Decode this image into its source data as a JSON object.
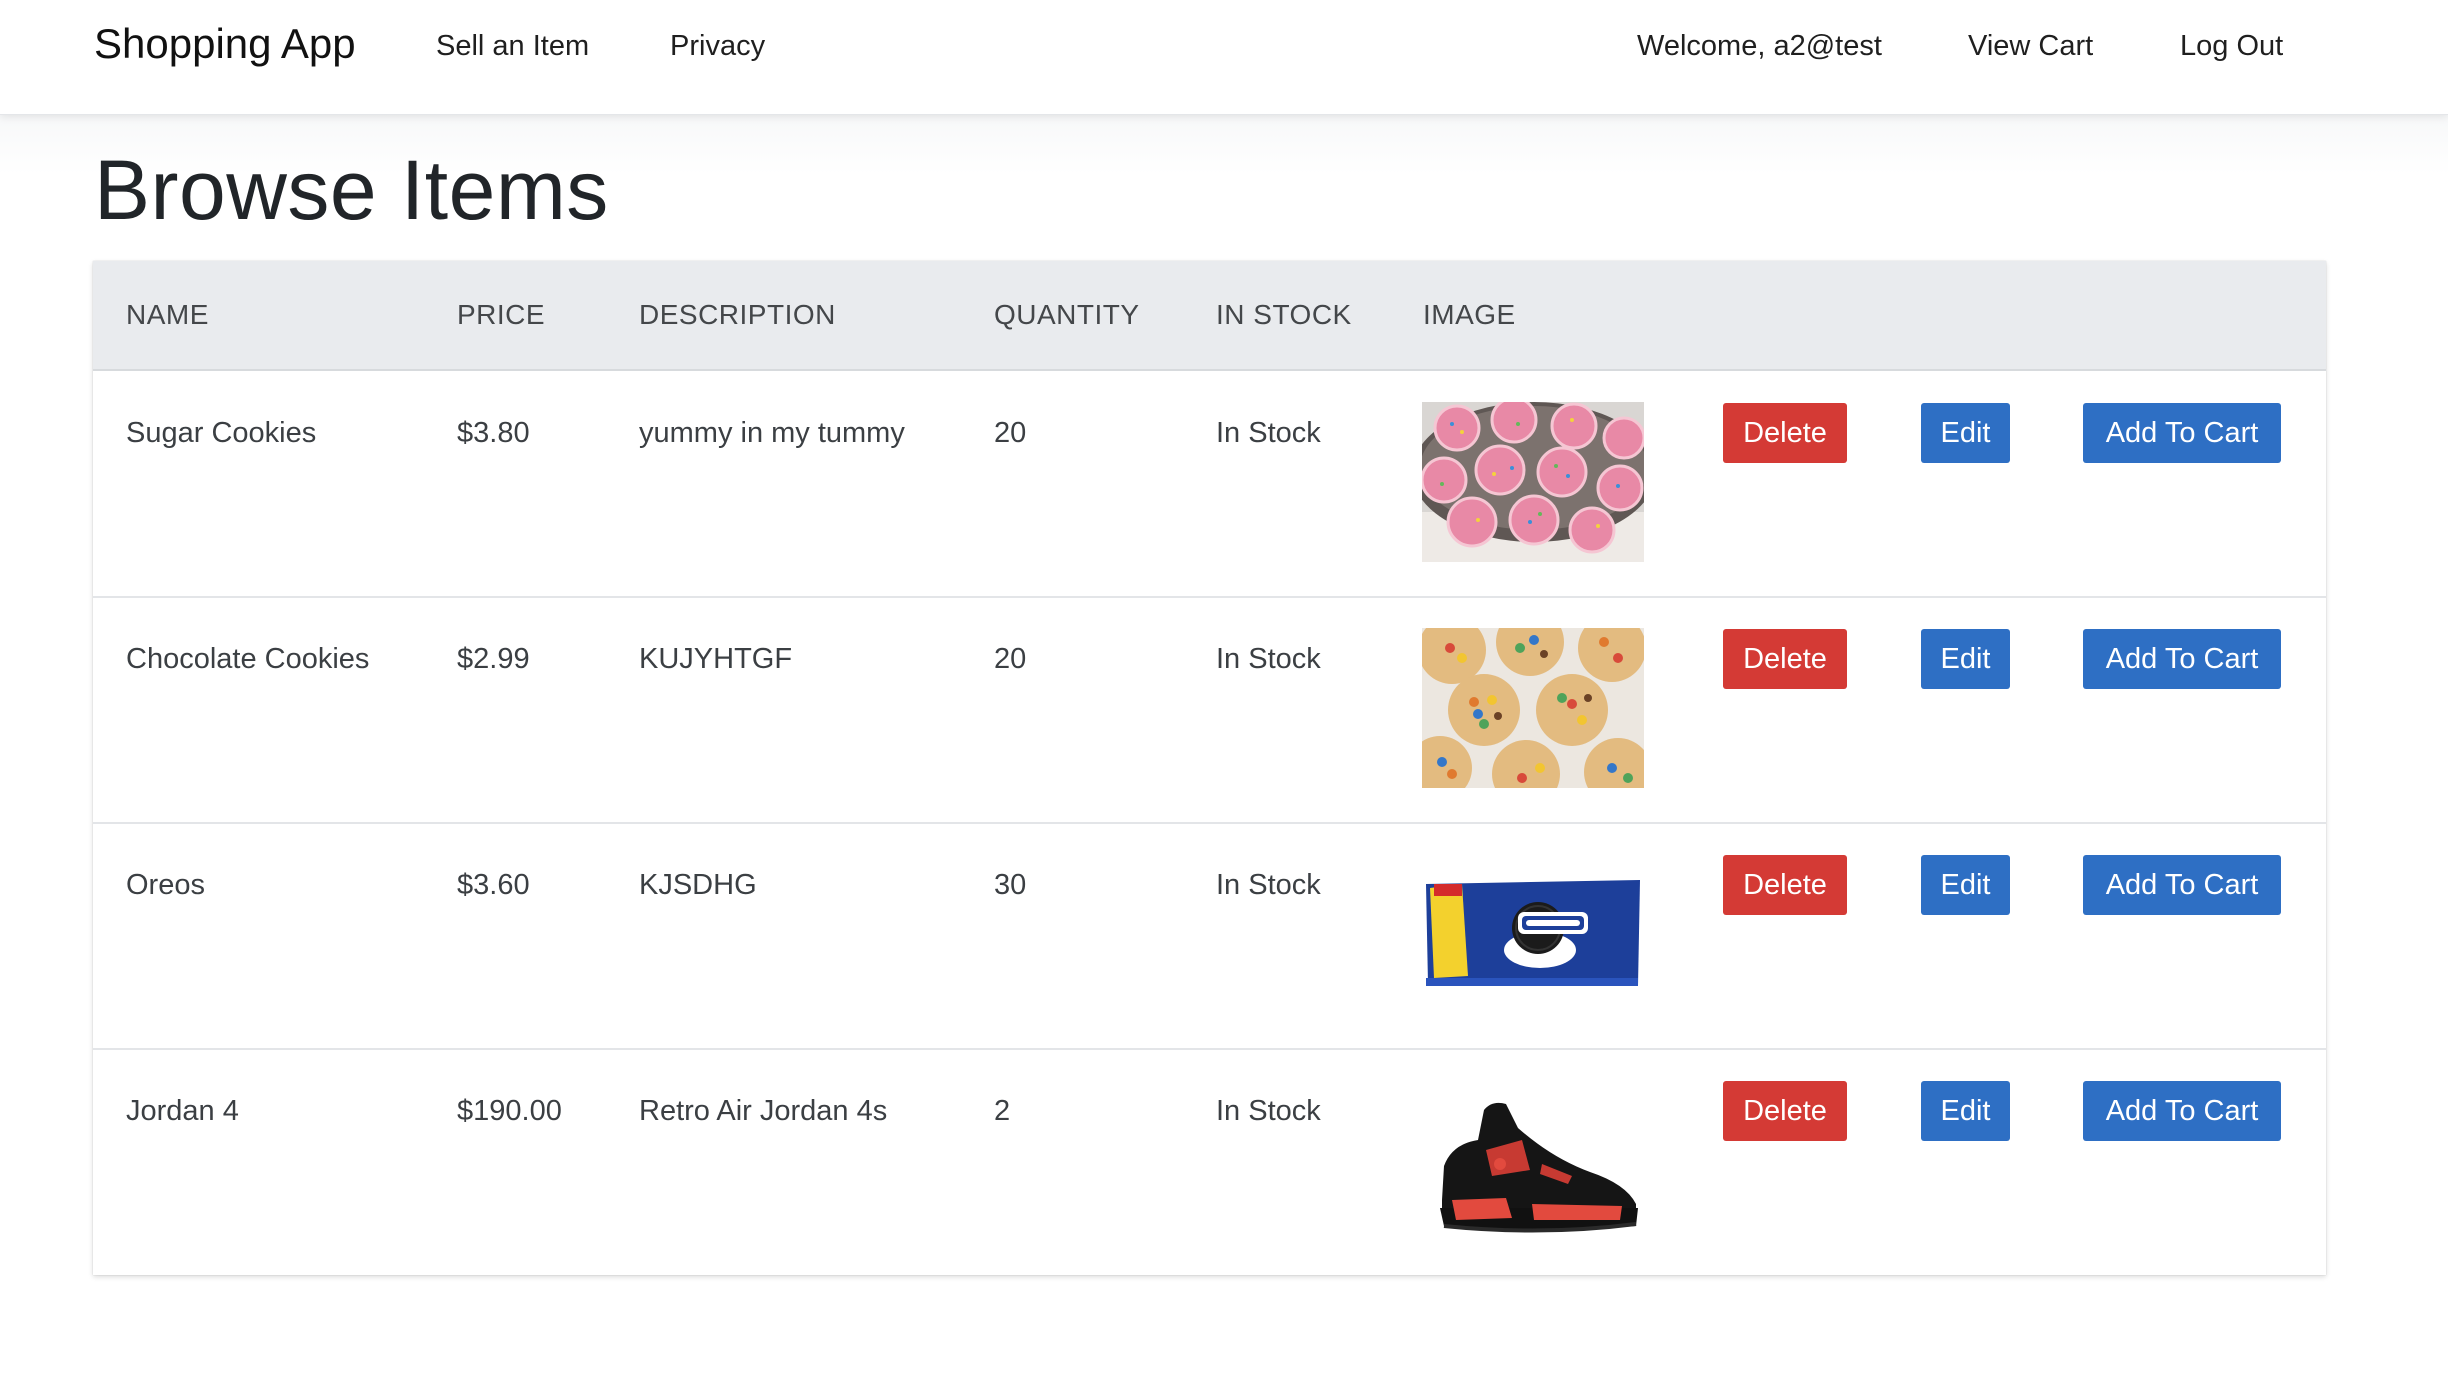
{
  "navbar": {
    "brand": "Shopping App",
    "links": {
      "sell": "Sell an Item",
      "privacy": "Privacy",
      "welcome": "Welcome, a2@test",
      "view_cart": "View Cart",
      "log_out": "Log Out"
    }
  },
  "page": {
    "title": "Browse Items"
  },
  "table": {
    "headers": {
      "name": "NAME",
      "price": "PRICE",
      "description": "DESCRIPTION",
      "quantity": "QUANTITY",
      "in_stock": "IN STOCK",
      "image": "IMAGE"
    },
    "rows": [
      {
        "name": "Sugar Cookies",
        "price": "$3.80",
        "description": "yummy in my tummy",
        "quantity": "20",
        "in_stock": "In Stock",
        "image": "sugar-cookies-photo"
      },
      {
        "name": "Chocolate Cookies",
        "price": "$2.99",
        "description": "KUJYHTGF",
        "quantity": "20",
        "in_stock": "In Stock",
        "image": "chocolate-cookies-photo"
      },
      {
        "name": "Oreos",
        "price": "$3.60",
        "description": "KJSDHG",
        "quantity": "30",
        "in_stock": "In Stock",
        "image": "oreo-package-photo"
      },
      {
        "name": "Jordan 4",
        "price": "$190.00",
        "description": "Retro Air Jordan 4s",
        "quantity": "2",
        "in_stock": "In Stock",
        "image": "jordan-sneaker-photo"
      }
    ],
    "actions": {
      "delete": "Delete",
      "edit": "Edit",
      "add_to_cart": "Add To Cart"
    }
  },
  "colors": {
    "delete_button": "#d43a35",
    "primary_button": "#2e6fc4",
    "table_header_bg": "#e9ebee"
  }
}
